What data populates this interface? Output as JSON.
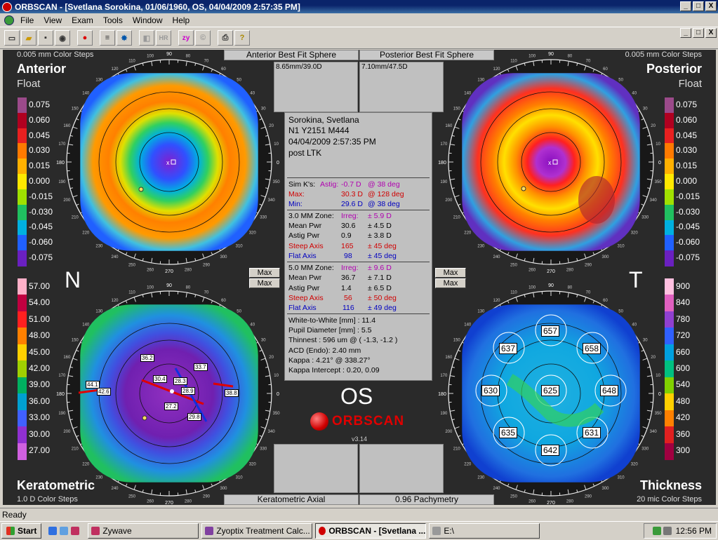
{
  "window": {
    "title": "ORBSCAN - [Svetlana Sorokina, 01/06/1960, OS, 04/04/2009 2:57:35 PM]",
    "min_label": "_",
    "max_label": "□",
    "close_label": "X"
  },
  "menu": [
    "File",
    "View",
    "Exam",
    "Tools",
    "Window",
    "Help"
  ],
  "toolbar": {
    "hr_label": "HR",
    "zy_label": "zy"
  },
  "header": {
    "left_steps": "0.005 mm Color Steps",
    "right_steps": "0.005 mm Color Steps",
    "anterior_tab": "Anterior Best Fit Sphere",
    "posterior_tab": "Posterior Best Fit Sphere",
    "anterior_value": "8.65mm/39.0D",
    "posterior_value": "7.10mm/47.5D",
    "anterior_title": "Anterior",
    "anterior_sub": "Float",
    "posterior_title": "Posterior",
    "posterior_sub": "Float"
  },
  "patient": {
    "name": "Sorokina, Svetlana",
    "id": "N1 Y2151 M444",
    "datetime": "04/04/2009 2:57:35 PM",
    "note": "post LTK"
  },
  "simk": {
    "label": "Sim K's:",
    "astig_label": "Astig:",
    "astig_val": "-0.7 D",
    "astig_deg": "@ 38 deg",
    "max_label": "Max:",
    "max_val": "30.3 D",
    "max_deg": "@ 128 deg",
    "min_label": "Min:",
    "min_val": "29.6 D",
    "min_deg": "@ 38 deg"
  },
  "zone3": {
    "label": "3.0 MM Zone:",
    "irreg_label": "Irreg:",
    "irreg_val": "± 5.9 D",
    "mean_label": "Mean Pwr",
    "mean_val": "30.6",
    "mean_dev": "± 4.5 D",
    "astig_label": "Astig Pwr",
    "astig_val": "0.9",
    "astig_dev": "± 3.8 D",
    "steep_label": "Steep Axis",
    "steep_val": "165",
    "steep_dev": "± 45 deg",
    "flat_label": "Flat Axis",
    "flat_val": "98",
    "flat_dev": "± 45 deg"
  },
  "zone5": {
    "label": "5.0 MM Zone:",
    "irreg_label": "Irreg:",
    "irreg_val": "± 9.6 D",
    "mean_label": "Mean Pwr",
    "mean_val": "36.7",
    "mean_dev": "± 7.1 D",
    "astig_label": "Astig Pwr",
    "astig_val": "1.4",
    "astig_dev": "± 6.5 D",
    "steep_label": "Steep Axis",
    "steep_val": "56",
    "steep_dev": "± 50 deg",
    "flat_label": "Flat Axis",
    "flat_val": "116",
    "flat_dev": "± 49 deg"
  },
  "misc": {
    "wtw": "White-to-White [mm] : 11.4",
    "pupil": "Pupil Diameter [mm] :  5.5",
    "thinnest": "Thinnest : 596 um @ ( -1.3, -1.2 )",
    "acd": "ACD (Endo): 2.40 mm",
    "kappa": "Kappa : 4.21° @ 338.27°",
    "kappa_int": "Kappa Intercept : 0.20, 0.09"
  },
  "eye": "OS",
  "brand": "ORBSCAN",
  "version": "v3.14",
  "max_buttons": [
    "Max",
    "Max",
    "Max",
    "Max"
  ],
  "sides": {
    "n": "N",
    "t": "T"
  },
  "bottom": {
    "kerato_title": "Keratometric",
    "kerato_steps": "1.0 D Color Steps",
    "thick_title": "Thickness",
    "thick_steps": "20 mic Color Steps",
    "kerato_tab": "Keratometric Axial",
    "pachy_tab": "0.96 Pachymetry"
  },
  "float_scale": [
    "0.075",
    "0.060",
    "0.045",
    "0.030",
    "0.015",
    "0.000",
    "-0.015",
    "-0.030",
    "-0.045",
    "-0.060",
    "-0.075"
  ],
  "kerato_scale": [
    "57.00",
    "54.00",
    "51.00",
    "48.00",
    "45.00",
    "42.00",
    "39.00",
    "36.00",
    "33.00",
    "30.00",
    "27.00"
  ],
  "thick_scale": [
    "900",
    "840",
    "780",
    "720",
    "660",
    "600",
    "540",
    "480",
    "420",
    "360",
    "300"
  ],
  "pachy_values": {
    "sup": "657",
    "ul": "637",
    "ur": "658",
    "l": "630",
    "c": "625",
    "r": "648",
    "ll": "635",
    "lr": "631",
    "inf": "642"
  },
  "kerato_values": {
    "a": "36.2",
    "b": "33.7",
    "c": "30.4",
    "d": "28.3",
    "e": "28.9",
    "f": "44.1",
    "g": "42.6",
    "h": "38.8",
    "i": "27.2",
    "j": "29.8"
  },
  "angle_labels": {
    "top": "90",
    "right": "0",
    "bottom": "270",
    "left": "180"
  },
  "status": "Ready",
  "taskbar": {
    "start": "Start",
    "t1": "Zywave",
    "t2": "Zyoptix Treatment Calc...",
    "t3": "ORBSCAN - [Svetlana ...",
    "t4": "E:\\",
    "clock": "12:56 PM"
  },
  "colors": {
    "float_scale": [
      "#9b4a8a",
      "#b00020",
      "#e82020",
      "#ff7a00",
      "#ffb000",
      "#ffe800",
      "#a0e000",
      "#20c060",
      "#00b0e0",
      "#2060ff",
      "#6a20c0"
    ]
  }
}
